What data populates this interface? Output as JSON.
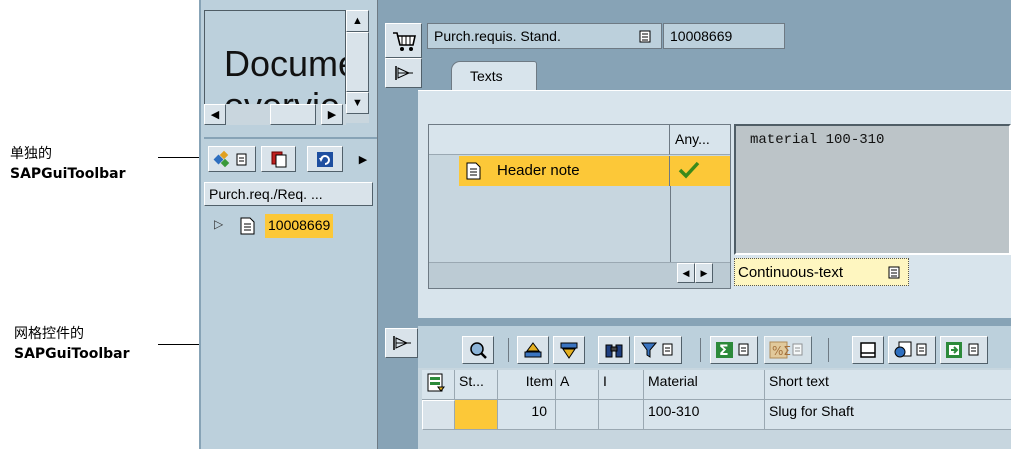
{
  "callouts": {
    "toolbar_standalone": {
      "line1": "单独的",
      "line2": "SAPGuiToolbar"
    },
    "toolbar_grid": {
      "line1": "网格控件的",
      "line2": "SAPGuiToolbar"
    }
  },
  "left_pane": {
    "preview_title": "Docume",
    "preview_title_2": "overvie",
    "column_header": "Purch.req./Req. ...",
    "tree_item": "10008669"
  },
  "header": {
    "doc_type": "Purch.requis. Stand.",
    "doc_number": "10008669"
  },
  "tabs": [
    {
      "label": "Texts",
      "active": true
    }
  ],
  "texts_panel": {
    "col_header": "Any...",
    "row_label": "Header note",
    "text_content": "material 100-310",
    "format_label": "Continuous-text"
  },
  "grid": {
    "columns": [
      "St...",
      "Item",
      "A",
      "I",
      "Material",
      "Short text"
    ],
    "rows": [
      {
        "status": "",
        "item": "10",
        "a": "",
        "i": "",
        "material": "100-310",
        "short_text": "Slug for Shaft"
      }
    ]
  },
  "colors": {
    "accent": "#fcc838",
    "background": "#bcd0dc",
    "frame": "#87a3b6"
  }
}
